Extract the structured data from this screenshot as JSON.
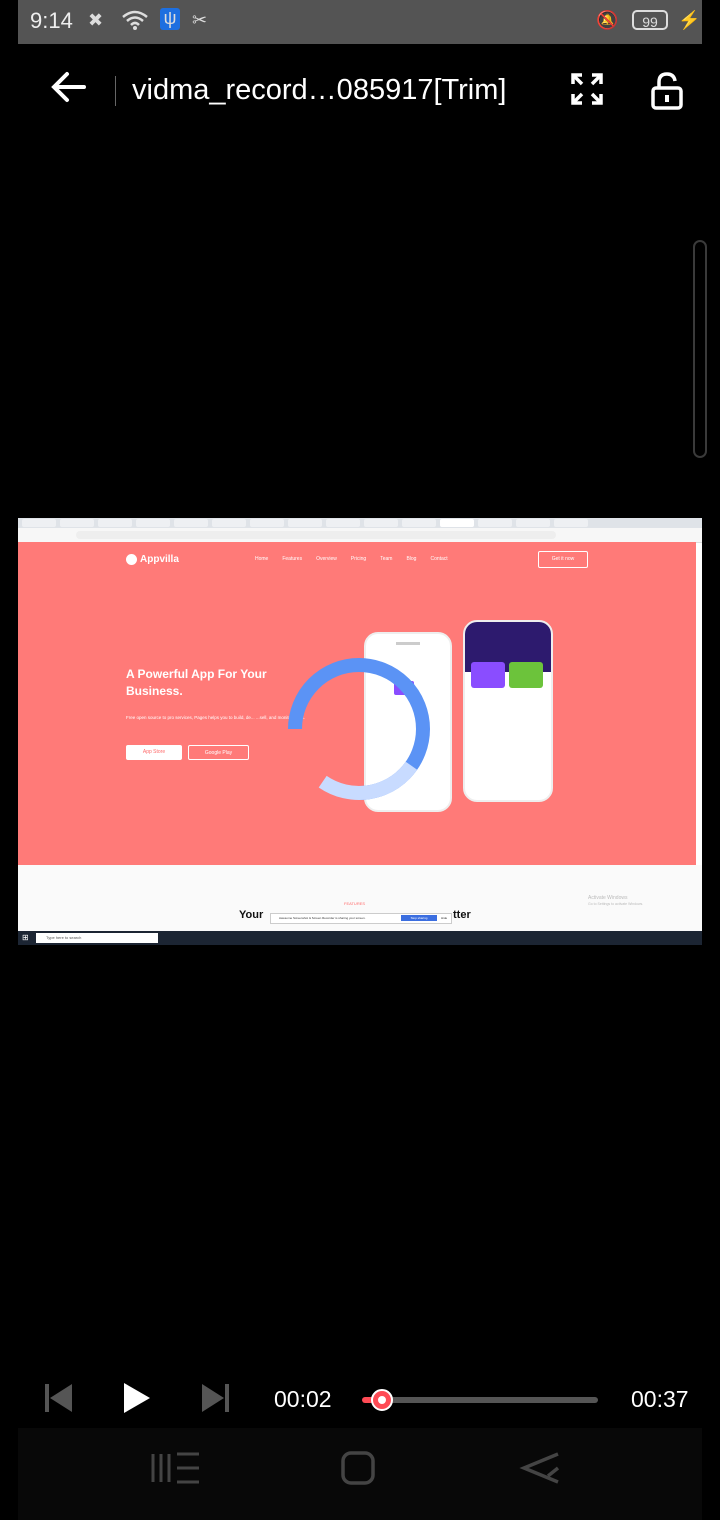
{
  "status_bar": {
    "time": "9:14",
    "battery": "99",
    "icons": [
      "close-notification-icon",
      "wifi-icon",
      "usb-icon",
      "video-trim-icon",
      "mute-vibrate-icon",
      "charging-icon"
    ]
  },
  "header": {
    "title": "vidma_record…085917[Trim]",
    "back_icon": "arrow-left-icon",
    "fullscreen_icon": "fullscreen-icon",
    "lock_icon": "unlock-icon"
  },
  "video_frame": {
    "site": {
      "brand": "Appvilla",
      "nav": [
        "Home",
        "Features",
        "Overview",
        "Pricing",
        "Team",
        "Blog",
        "Contact"
      ],
      "cta": "Get it now",
      "headline": "A Powerful App For Your Business.",
      "lead": "Free open source to pro services, Pages helps you to build, de... ...sell, and monitor apps.",
      "app_store": "App Store",
      "google_play": "Google Play",
      "features_label": "FEATURES",
      "features_heading_left": "Your",
      "features_heading_right": "tter",
      "share_text": "Awesome Screenshot & Screen Recorder is sharing your screen.",
      "stop_sharing": "Stop sharing",
      "hide": "Hide",
      "activate_title": "Activate Windows",
      "activate_sub": "Go to Settings to activate Windows.",
      "taskbar_search": "Type here to search"
    }
  },
  "player": {
    "current_time": "00:02",
    "duration": "00:37",
    "progress_fraction": 0.054,
    "prev_icon": "skip-previous-icon",
    "play_icon": "play-icon",
    "next_icon": "skip-next-icon"
  },
  "system_nav": {
    "recent_icon": "recent-apps-icon",
    "home_icon": "home-icon",
    "back_icon": "back-icon"
  },
  "colors": {
    "accent": "#ff4b55",
    "hero": "#ff7a78"
  }
}
